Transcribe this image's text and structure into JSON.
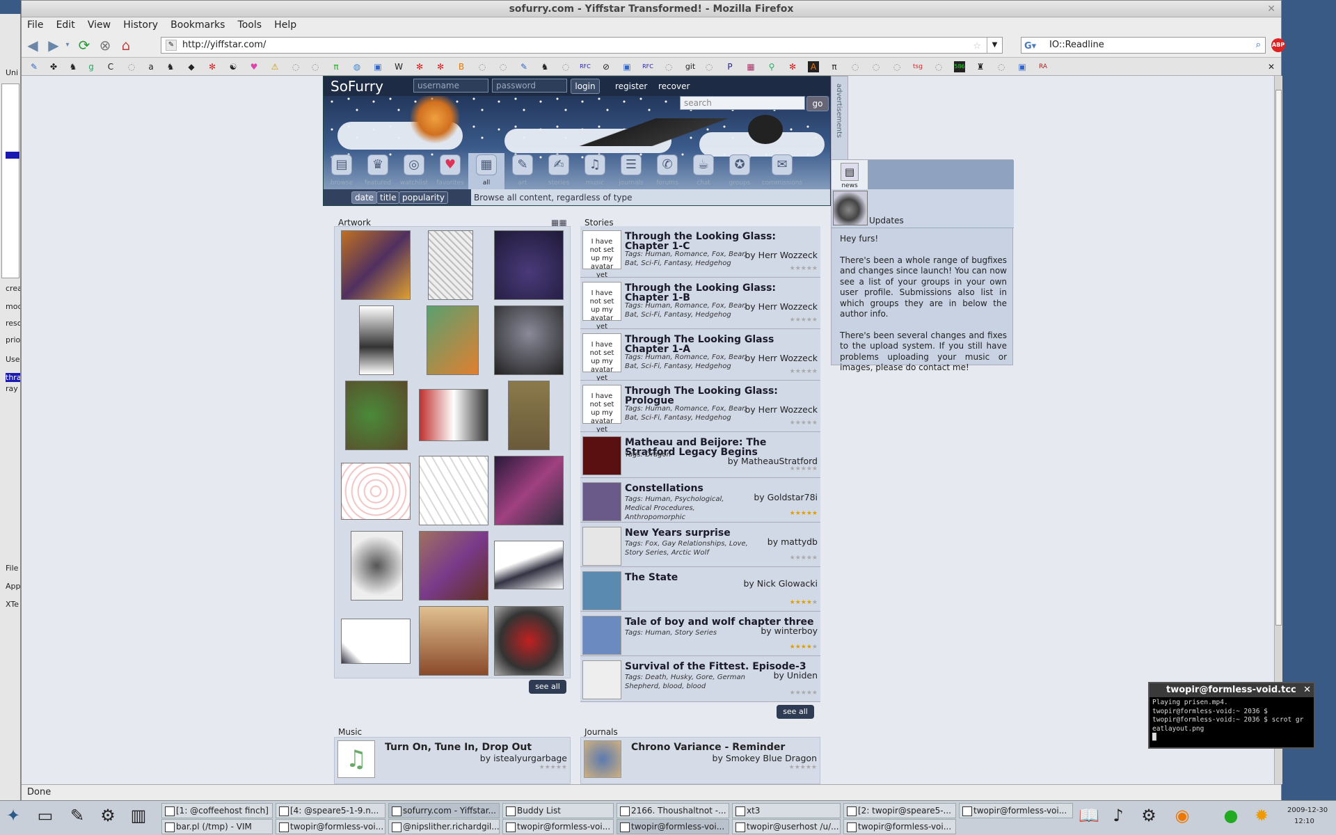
{
  "window": {
    "title": "sofurry.com - Yiffstar Transformed! - Mozilla Firefox"
  },
  "menu": [
    "File",
    "Edit",
    "View",
    "History",
    "Bookmarks",
    "Tools",
    "Help"
  ],
  "urlbar": {
    "url": "http://yiffstar.com/"
  },
  "searchbar": {
    "value": "IO::Readline"
  },
  "bookmarks": [
    "Wikipedia",
    "Amazon",
    "Readline",
    "git",
    "RFC",
    "RFC XHTML",
    "tsg",
    "ra"
  ],
  "status": "Done",
  "left_panel": [
    "Uni",
    "crea",
    "mod",
    "reso",
    "prio",
    "Use",
    "thra",
    "ray",
    "File",
    "App",
    "XTe"
  ],
  "site": {
    "logo": "SoFurry",
    "username_placeholder": "username",
    "password_placeholder": "password",
    "login": "login",
    "register": "register",
    "recover": "recover",
    "search_placeholder": "search",
    "go": "go",
    "advertisements": "advertisements",
    "nav": [
      {
        "label": "browse",
        "icon": "browse-icon"
      },
      {
        "label": "featured",
        "icon": "featured-icon"
      },
      {
        "label": "watchlist",
        "icon": "watchlist-icon"
      },
      {
        "label": "favorites",
        "icon": "favorites-icon"
      },
      {
        "label": "all",
        "icon": "all-icon"
      },
      {
        "label": "art",
        "icon": "art-icon"
      },
      {
        "label": "stories",
        "icon": "stories-icon"
      },
      {
        "label": "music",
        "icon": "music-icon"
      },
      {
        "label": "journals",
        "icon": "journals-icon"
      },
      {
        "label": "forums",
        "icon": "forums-icon"
      },
      {
        "label": "chat",
        "icon": "chat-icon"
      },
      {
        "label": "groups",
        "icon": "groups-icon"
      },
      {
        "label": "commissions",
        "icon": "commissions-icon"
      },
      {
        "label": "news",
        "icon": "news-icon"
      }
    ],
    "sort": [
      "date",
      "title",
      "popularity"
    ],
    "sort_desc": "Browse all content, regardless of type",
    "artwork_title": "Artwork",
    "stories_title": "Stories",
    "music_title": "Music",
    "journals_title": "Journals",
    "see_all": "see all",
    "avatar_placeholder": "I have not set up my avatar yet",
    "stories": [
      {
        "title": "Through the Looking Glass: Chapter 1-C",
        "author": "by Herr Wozzeck",
        "tags": "Tags: Human, Romance, Fox, Bear, Bat, Sci-Fi, Fantasy, Hedgehog",
        "rating": 0
      },
      {
        "title": "Through the Looking Glass: Chapter 1-B",
        "author": "by Herr Wozzeck",
        "tags": "Tags: Human, Romance, Fox, Bear, Bat, Sci-Fi, Fantasy, Hedgehog",
        "rating": 0
      },
      {
        "title": "Through The Looking Glass Chapter 1-A",
        "author": "by Herr Wozzeck",
        "tags": "Tags: Human, Romance, Fox, Bear, Bat, Sci-Fi, Fantasy, Hedgehog",
        "rating": 0
      },
      {
        "title": "Through The Looking Glass: Prologue",
        "author": "by Herr Wozzeck",
        "tags": "Tags: Human, Romance, Fox, Bear, Bat, Sci-Fi, Fantasy, Hedgehog",
        "rating": 0
      },
      {
        "title": "Matheau and Beijore: The Stratford Legacy Begins",
        "author": "by MatheauStratford",
        "tags": "Tags: Dragon",
        "rating": 0
      },
      {
        "title": "Constellations",
        "author": "by Goldstar78i",
        "tags": "Tags: Human, Psychological, Medical Procedures, Anthropomorphic",
        "rating": 5
      },
      {
        "title": "New Years surprise",
        "author": "by mattydb",
        "tags": "Tags: Fox, Gay Relationships, Love, Story Series, Arctic Wolf",
        "rating": 0
      },
      {
        "title": "The State",
        "author": "by Nick Glowacki",
        "tags": "",
        "rating": 4
      },
      {
        "title": "Tale of boy and wolf chapter three",
        "author": "by winterboy",
        "tags": "Tags: Human, Story Series",
        "rating": 4
      },
      {
        "title": "Survival of the Fittest. Episode-3",
        "author": "by Uniden",
        "tags": "Tags: Death, Husky, Gore, German Shepherd, blood, blood",
        "rating": 0
      }
    ],
    "music": {
      "title": "Turn On, Tune In, Drop Out",
      "author": "by istealyurgarbage"
    },
    "journal": {
      "title": "Chrono Variance - Reminder",
      "author": "by Smokey Blue Dragon"
    },
    "news": {
      "tab": "news",
      "updates": "Updates",
      "p1": "Hey furs!",
      "p2": "There's been a whole range of bugfixes and changes since launch! You can now see a list of your groups in your own user profile. Submissions also list in which groups they are in below the author info.",
      "p3": "There's been several changes and fixes to the upload system. If you still have problems uploading your music or images, please do contact me!"
    }
  },
  "terminal": {
    "title": "twopir@formless-void.tcc",
    "lines": "Playing prisen.mp4.\ntwopir@formless-void:~ 2036 $\ntwopir@formless-void:~ 2036 $ scrot gr\neatlayout.png\n█"
  },
  "taskbar": {
    "row1": [
      "[1: @coffeehost finch]",
      "[4: @speare5-1-9.n...",
      "sofurry.com - Yiffstar...",
      "Buddy List",
      "2166. Thoushaltnot -...",
      "xt3",
      "[2: twopir@speare5-...",
      "twopir@formless-voi..."
    ],
    "row2": [
      "bar.pl (/tmp) - VIM",
      "twopir@formless-voi...",
      "@nipslither.richardgil...",
      "twopir@formless-voi...",
      "twopir@formless-voi...",
      "twopir@userhost /u/...",
      "twopir@formless-voi..."
    ],
    "date": "2009-12-30",
    "time": "12:10"
  },
  "colors": {
    "accent": "#1d2b45",
    "panel": "#d5dce8",
    "background": "#e6e9ef"
  }
}
